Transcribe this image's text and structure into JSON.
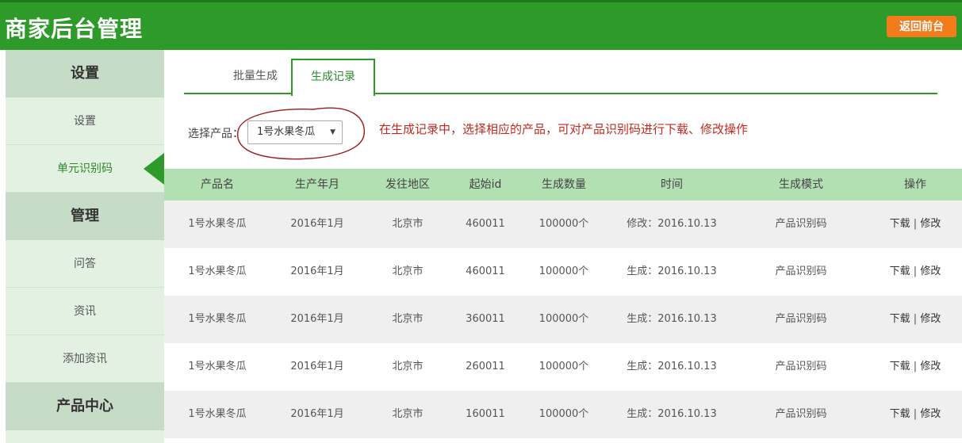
{
  "header": {
    "title": "商家后台管理",
    "back_button": "返回前台"
  },
  "sidebar": {
    "sections": [
      {
        "title": "设置",
        "items": [
          "设置",
          "单元识别码"
        ]
      },
      {
        "title": "管理",
        "items": [
          "问答",
          "资讯",
          "添加资讯"
        ]
      },
      {
        "title": "产品中心",
        "items": []
      }
    ],
    "active_item": "单元识别码"
  },
  "tabs": [
    "批量生成",
    "生成记录"
  ],
  "active_tab": "生成记录",
  "filter": {
    "label": "选择产品：",
    "selected": "1号水果冬瓜"
  },
  "annotation": "在生成记录中，选择相应的产品，可对产品识别码进行下载、修改操作",
  "table": {
    "headers": [
      "产品名",
      "生产年月",
      "发往地区",
      "起始id",
      "生成数量",
      "时间",
      "生成模式",
      "操作"
    ],
    "rows": [
      [
        "1号水果冬瓜",
        "2016年1月",
        "北京市",
        "460011",
        "100000个",
        "修改：2016.10.13",
        "产品识别码"
      ],
      [
        "1号水果冬瓜",
        "2016年1月",
        "北京市",
        "460011",
        "100000个",
        "生成：2016.10.13",
        "产品识别码"
      ],
      [
        "1号水果冬瓜",
        "2016年1月",
        "北京市",
        "360011",
        "100000个",
        "生成：2016.10.13",
        "产品识别码"
      ],
      [
        "1号水果冬瓜",
        "2016年1月",
        "北京市",
        "260011",
        "100000个",
        "生成：2016.10.13",
        "产品识别码"
      ],
      [
        "1号水果冬瓜",
        "2016年1月",
        "北京市",
        "160011",
        "100000个",
        "生成：2016.10.13",
        "产品识别码"
      ]
    ],
    "actions": {
      "download": "下载",
      "edit": "修改",
      "separator": "|"
    }
  }
}
